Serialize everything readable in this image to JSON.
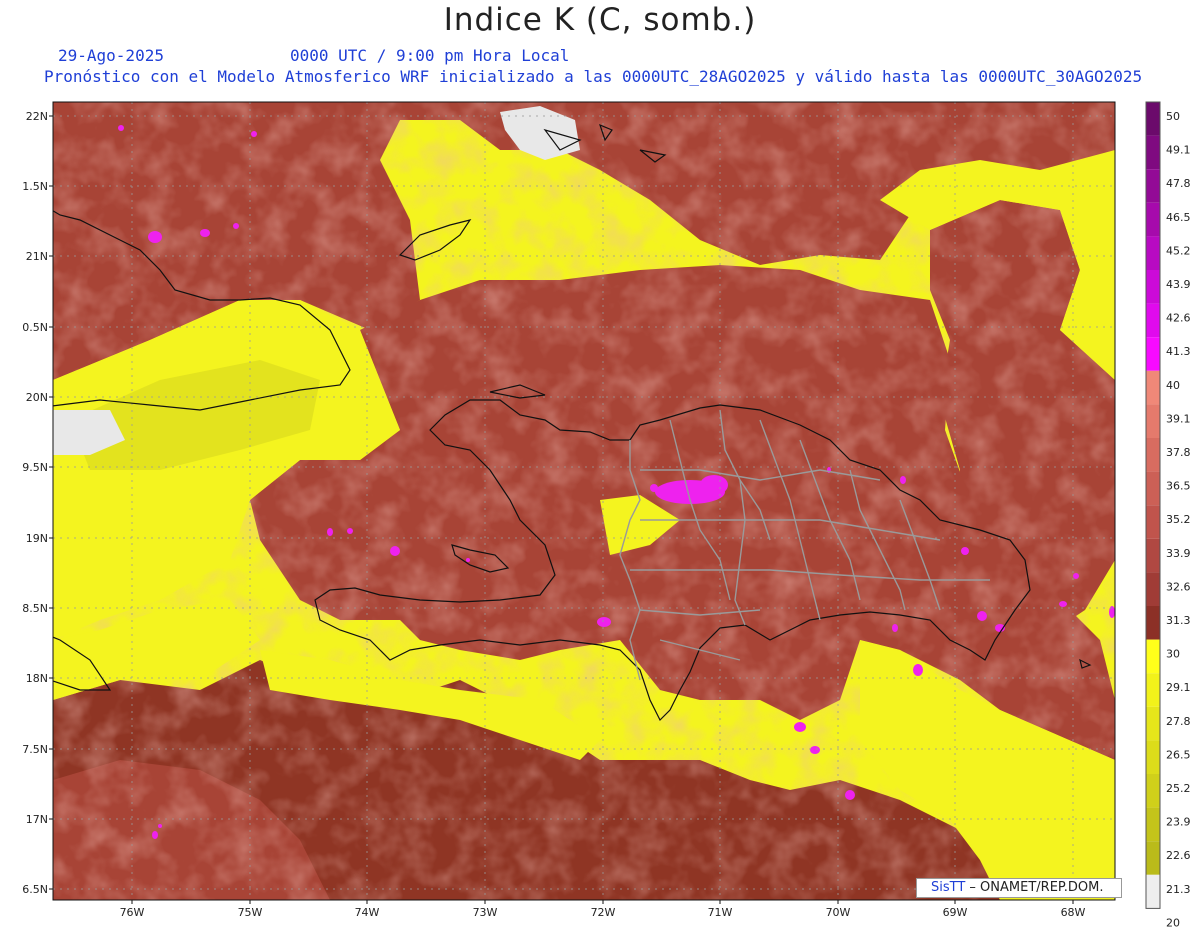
{
  "title": "Indice K (C, somb.)",
  "date": "29-Ago-2025",
  "valid_time": "0000 UTC / 9:00 pm Hora Local",
  "description": "Pronóstico con el Modelo Atmosferico WRF inicializado a las 0000UTC_28AGO2025 y válido hasta las  0000UTC_30AGO2025",
  "credit": {
    "brand": "SisTT",
    "agency": " – ONAMET/REP.DOM."
  },
  "axes": {
    "lat_labels": [
      "22N",
      "1.5N",
      "21N",
      "0.5N",
      "20N",
      "9.5N",
      "19N",
      "8.5N",
      "18N",
      "7.5N",
      "17N",
      "6.5N"
    ],
    "lon_labels": [
      "76W",
      "75W",
      "74W",
      "73W",
      "72W",
      "71W",
      "70W",
      "69W",
      "68W"
    ]
  },
  "colorbar": {
    "ticks": [
      "50",
      "49.1",
      "47.8",
      "46.5",
      "45.2",
      "43.9",
      "42.6",
      "41.3",
      "40",
      "39.1",
      "37.8",
      "36.5",
      "35.2",
      "33.9",
      "32.6",
      "31.3",
      "30",
      "29.1",
      "27.8",
      "26.5",
      "25.2",
      "23.9",
      "22.6",
      "21.3",
      "20"
    ],
    "colors": [
      "#6b0a6b",
      "#7f0a80",
      "#930a96",
      "#a60aac",
      "#b80ac2",
      "#cc0ad8",
      "#e00aed",
      "#f70aff",
      "#f08878",
      "#e57a6c",
      "#d86c60",
      "#cc6056",
      "#c0544c",
      "#b04842",
      "#a03c36",
      "#8c3026",
      "#ffff1a",
      "#f2f21a",
      "#e6e61a",
      "#dcdc1a",
      "#d0d01a",
      "#c4c41a",
      "#babb1a",
      "#eeeeee"
    ]
  },
  "colors": {
    "land_dark": "#913a26",
    "land_mid": "#b95a4a",
    "land_light": "#d4776a",
    "low_k": "#f4f41f",
    "no_data": "#e8e8e8",
    "high_k": "#ee22ee"
  }
}
